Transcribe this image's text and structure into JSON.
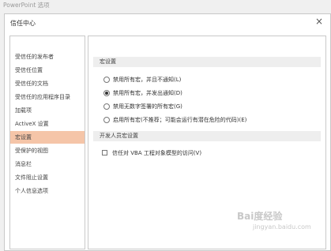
{
  "window": {
    "app_title": "PowerPoint 选项"
  },
  "dialog": {
    "title": "信任中心",
    "close_glyph": "×"
  },
  "sidebar": {
    "items": [
      {
        "label": "受信任的发布者",
        "active": false
      },
      {
        "label": "受信任位置",
        "active": false
      },
      {
        "label": "受信任的文档",
        "active": false
      },
      {
        "label": "受信任的应用程序目录",
        "active": false
      },
      {
        "label": "加载项",
        "active": false
      },
      {
        "label": "ActiveX 设置",
        "active": false
      },
      {
        "label": "宏设置",
        "active": true
      },
      {
        "label": "受保护的视图",
        "active": false
      },
      {
        "label": "消息栏",
        "active": false
      },
      {
        "label": "文件阻止设置",
        "active": false
      },
      {
        "label": "个人信息选项",
        "active": false
      }
    ],
    "active_color": "#f5c5a8"
  },
  "macro_settings": {
    "header": "宏设置",
    "options": [
      {
        "label": "禁用所有宏，并且不通知(L)",
        "checked": false
      },
      {
        "label": "禁用所有宏，并发出通知(D)",
        "checked": true
      },
      {
        "label": "禁用无数字签署的所有宏(G)",
        "checked": false
      },
      {
        "label": "启用所有宏(不推荐；可能会运行有潜在危险的代码)(E)",
        "checked": false
      }
    ]
  },
  "developer_settings": {
    "header": "开发人员宏设置",
    "vba_access": {
      "label": "信任对 VBA 工程对象模型的访问(V)",
      "checked": false
    }
  },
  "watermark": {
    "main": "Bai度经验",
    "sub": "jingyan.baidu.com"
  }
}
